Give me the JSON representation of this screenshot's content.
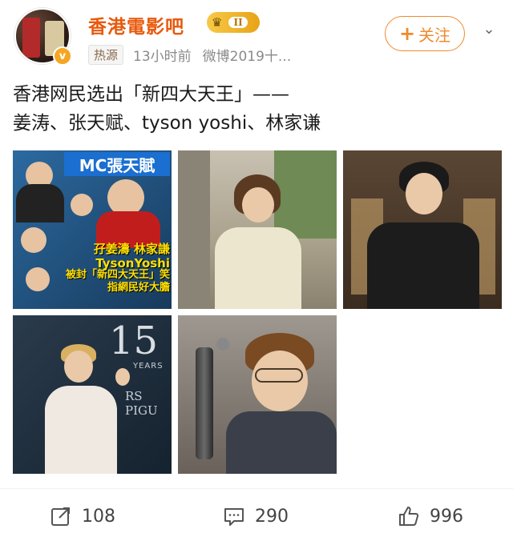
{
  "header": {
    "username": "香港電影吧",
    "level_badge": "II",
    "hot_tag": "热源",
    "time": "13小时前",
    "source": "微博2019十...",
    "follow_label": "关注",
    "verified_mark": "v"
  },
  "post": {
    "line1": "香港网民选出「新四大天王」——",
    "line2": "姜涛、张天赋、tyson yoshi、林家谦"
  },
  "images": {
    "p1_title": "MC張天賦",
    "p1_caption1": "孖姜濤 林家謙 TysonYoshi",
    "p1_caption2": "被封「新四大天王」笑指網民好大膽",
    "p4_number": "15",
    "p4_years": "YEARS",
    "p4_brand": "RS PIGU"
  },
  "actions": {
    "share_count": "108",
    "comment_count": "290",
    "like_count": "996"
  },
  "colors": {
    "username": "#e8590c",
    "follow": "#f08a2c",
    "badge": "#f7c948"
  },
  "icons": [
    "verified-icon",
    "crown-icon",
    "more-icon",
    "share-icon",
    "comment-icon",
    "like-icon"
  ]
}
